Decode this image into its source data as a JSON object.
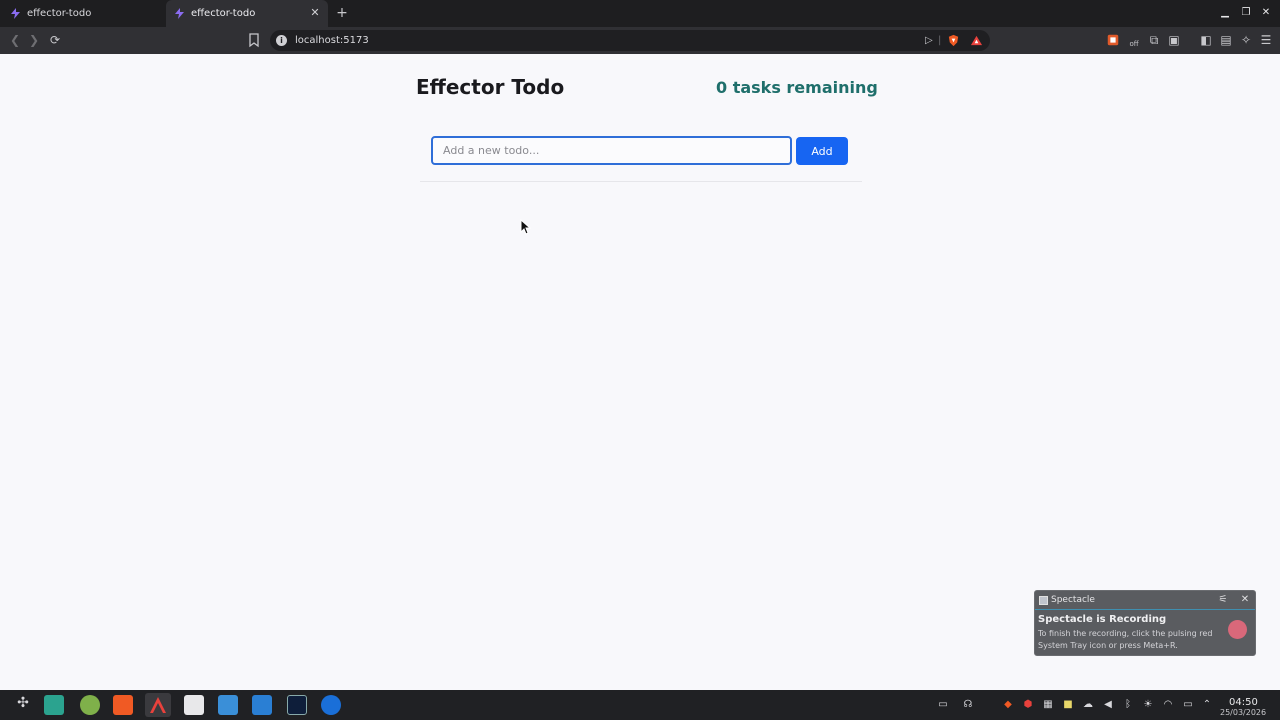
{
  "browser": {
    "tabs": [
      {
        "label": "effector-todo",
        "active": false
      },
      {
        "label": "effector-todo",
        "active": true
      }
    ],
    "new_tab_label": "+",
    "url": "localhost:5173",
    "shields_off_label": "off"
  },
  "app": {
    "title": "Effector Todo",
    "remaining_text": "0 tasks remaining",
    "input_placeholder": "Add a new todo...",
    "input_value": "",
    "add_label": "Add"
  },
  "notification": {
    "app_name": "Spectacle",
    "title": "Spectacle is Recording",
    "body": "To finish the recording, click the pulsing red System Tray icon or press Meta+R."
  },
  "taskbar": {
    "time": "04:50",
    "date": "25/03/2026"
  },
  "colors": {
    "accent": "#1765f2",
    "remaining": "#1f6f6b",
    "input_border": "#2f6ed8",
    "recording": "#d9687a"
  }
}
